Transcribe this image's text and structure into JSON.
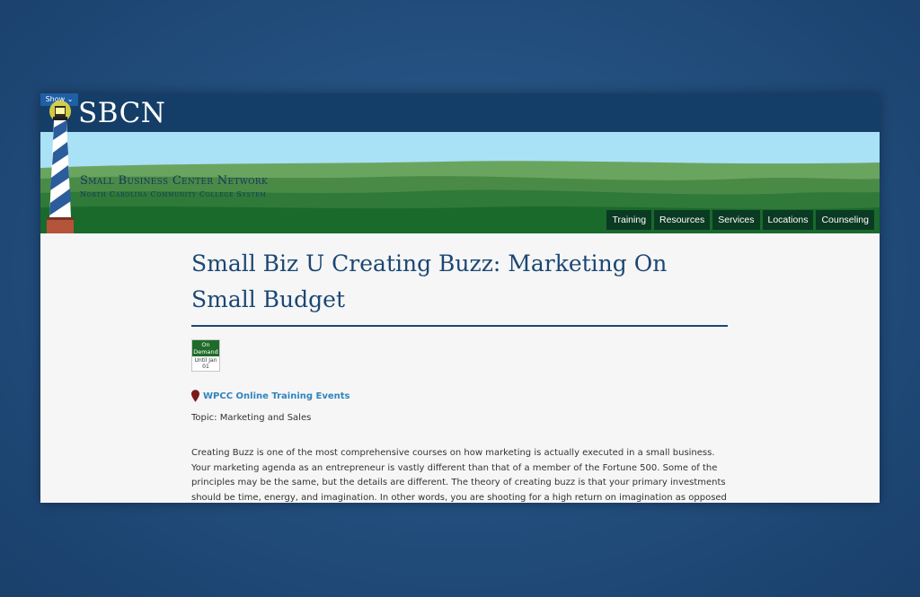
{
  "header": {
    "show_label": "Show ⌄",
    "brand": "SBCN",
    "org_name": "Small Business Center Network",
    "org_subtitle": "North Carolina Community College System"
  },
  "nav": {
    "items": [
      {
        "label": "Training"
      },
      {
        "label": "Resources"
      },
      {
        "label": "Services"
      },
      {
        "label": "Locations"
      },
      {
        "label": "Counseling"
      }
    ]
  },
  "event": {
    "title": "Small Biz U Creating Buzz: Marketing On Small Budget",
    "badge_top": "On Demand",
    "badge_bottom": "Until Jan 01",
    "location": "WPCC Online Training Events",
    "topic": "Topic: Marketing and Sales",
    "description": "Creating Buzz is one of the most comprehensive courses on how marketing is actually executed in a small business. Your marketing agenda as an entrepreneur is vastly different than that of a member of the Fortune 500. Some of the principles may be the same, but the details are different. The theory of creating buzz is that your primary investments should be time, energy, and imagination. In other words, you are shooting for a high return on imagination as opposed to return on investment."
  },
  "colors": {
    "header_bg": "#143e67",
    "nav_bg": "#0b3a22",
    "title": "#1b4774",
    "link": "#2f84bd",
    "badge": "#1f6b2a"
  }
}
